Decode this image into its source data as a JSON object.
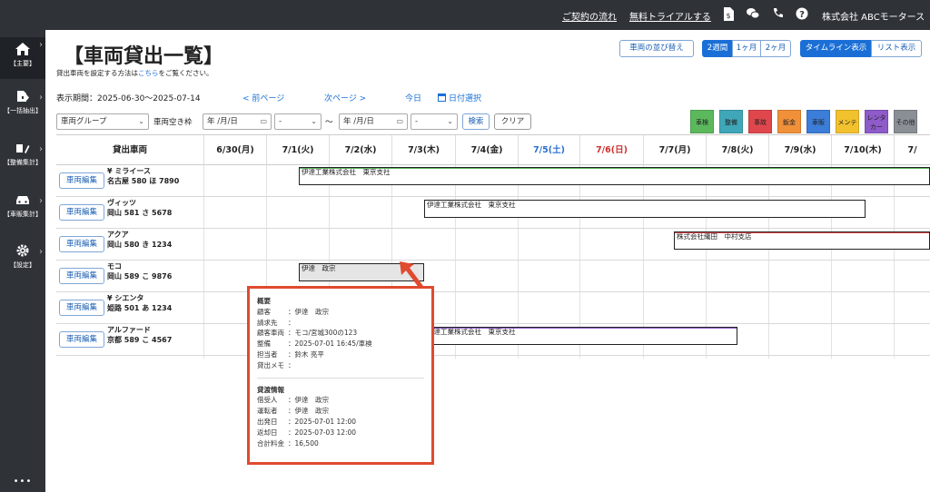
{
  "topbar": {
    "links": [
      "ご契約の流れ",
      "無料トライアルする"
    ],
    "icons": [
      "dollar-doc-icon",
      "chat-icon",
      "phone-icon",
      "help-icon"
    ],
    "company": "株式会社 ABCモータース"
  },
  "sidebar": {
    "items": [
      {
        "label": "【主要】",
        "icon": "home-icon"
      },
      {
        "label": "【一括抽出】",
        "icon": "export-icon"
      },
      {
        "label": "【整備集計】",
        "icon": "tools-icon"
      },
      {
        "label": "【車販集計】",
        "icon": "car-icon"
      },
      {
        "label": "【設定】",
        "icon": "gear-icon"
      }
    ],
    "more": "•••"
  },
  "page": {
    "title": "【車両貸出一覧】",
    "note_prefix": "貸出車両を設定する方法は",
    "note_link": "こちら",
    "note_suffix": "をご覧ください。"
  },
  "buttons": {
    "sort": "車両の並び替え",
    "range": [
      "2週間",
      "1ヶ月",
      "2ヶ月"
    ],
    "views": [
      "タイムライン表示",
      "リスト表示"
    ]
  },
  "period": {
    "label": "表示期間：2025-06-30〜2025-07-14",
    "prev": "< 前ページ",
    "next": "次ページ >",
    "today": "今日",
    "date_select": "日付選択"
  },
  "filters": {
    "group": "車両グループ",
    "vacancy_label": "車両空き枠",
    "date_placeholder": "年 /月/日",
    "time_placeholder": "-",
    "tilde": "〜",
    "search": "検索",
    "clear": "クリア"
  },
  "legend": [
    {
      "label": "車検",
      "color": "#5cb85c"
    },
    {
      "label": "整備",
      "color": "#3fa7b8"
    },
    {
      "label": "事故",
      "color": "#e0474c"
    },
    {
      "label": "鈑金",
      "color": "#f0913a"
    },
    {
      "label": "車販",
      "color": "#3b7dd8"
    },
    {
      "label": "メンテ",
      "color": "#f2c12e"
    },
    {
      "label": "レンタカー",
      "color": "#8e5bc9"
    },
    {
      "label": "その他",
      "color": "#8a8f96"
    }
  ],
  "grid": {
    "vehicle_header": "貸出車両",
    "dates": [
      {
        "label": "6/30(月)",
        "color": "#222"
      },
      {
        "label": "7/1(火)",
        "color": "#222"
      },
      {
        "label": "7/2(水)",
        "color": "#222"
      },
      {
        "label": "7/3(木)",
        "color": "#222"
      },
      {
        "label": "7/4(金)",
        "color": "#222"
      },
      {
        "label": "7/5(土)",
        "color": "#2a6fd0"
      },
      {
        "label": "7/6(日)",
        "color": "#d03030"
      },
      {
        "label": "7/7(月)",
        "color": "#222"
      },
      {
        "label": "7/8(火)",
        "color": "#222"
      },
      {
        "label": "7/9(水)",
        "color": "#222"
      },
      {
        "label": "7/10(木)",
        "color": "#222"
      },
      {
        "label": "7/",
        "color": "#222"
      }
    ],
    "edit_label": "車両編集",
    "vehicles": [
      {
        "name": "¥ ミライース",
        "plate": "名古屋 580 ほ 7890"
      },
      {
        "name": "ヴィッツ",
        "plate": "岡山 581 さ 5678"
      },
      {
        "name": "アクア",
        "plate": "岡山 580 き 1234"
      },
      {
        "name": "モコ",
        "plate": "岡山 589 こ 9876"
      },
      {
        "name": "¥ シエンタ",
        "plate": "姫路 501 あ 1234"
      },
      {
        "name": "アルファード",
        "plate": "京都 589 こ 4567"
      }
    ],
    "bookings": [
      {
        "text": "伊達工業株式会社　東京支社",
        "topcolor": "#5cb85c"
      },
      {
        "text": "伊達工業株式会社　東京支社",
        "topcolor": ""
      },
      {
        "text": "株式会社織田　中村支店",
        "topcolor": "#e0474c"
      },
      {
        "text": "伊達　政宗",
        "topcolor": ""
      },
      {
        "text": "伊達工業株式会社　東京支社",
        "topcolor": "#8e5bc9"
      }
    ]
  },
  "popup": {
    "overview_title": "概要",
    "overview": [
      {
        "k": "顧客",
        "v": "：伊達　政宗"
      },
      {
        "k": "請求先",
        "v": "："
      },
      {
        "k": "顧客車両",
        "v": "：モコ/宮城300の123"
      },
      {
        "k": "整備",
        "v": "：2025-07-01 16:45/車検"
      },
      {
        "k": "担当者",
        "v": "：鈴木 亮平"
      },
      {
        "k": "貸出メモ",
        "v": "："
      }
    ],
    "lend_title": "貸渡情報",
    "lend": [
      {
        "k": "借受人",
        "v": "：伊達　政宗"
      },
      {
        "k": "運転者",
        "v": "：伊達　政宗"
      },
      {
        "k": "出発日",
        "v": "：2025-07-01 12:00"
      },
      {
        "k": "返却日",
        "v": "：2025-07-03 12:00"
      },
      {
        "k": "合計料金",
        "v": "：16,500"
      }
    ]
  }
}
